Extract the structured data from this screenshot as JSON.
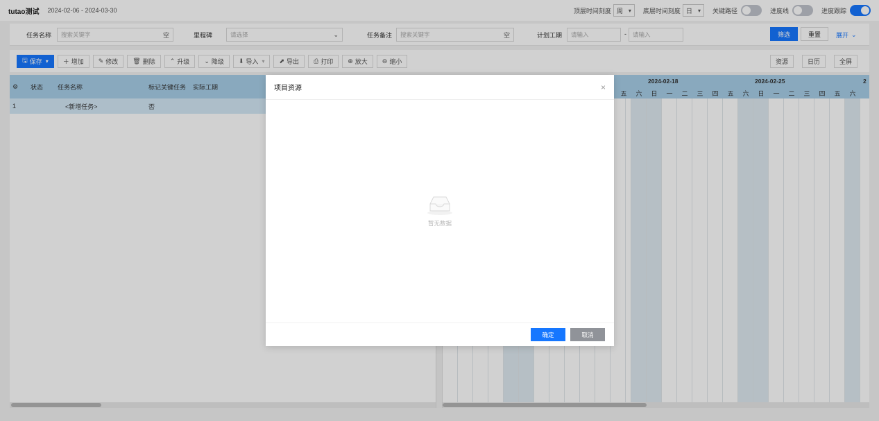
{
  "header": {
    "title": "tutao测试",
    "date_range": "2024-02-06 - 2024-03-30",
    "top_scale_label": "顶层时间刻度",
    "top_scale_value": "周",
    "bottom_scale_label": "底层时间刻度",
    "bottom_scale_value": "日",
    "critical_path_label": "关键路径",
    "progress_line_label": "进度线",
    "progress_track_label": "进度跟踪"
  },
  "filters": {
    "task_name_label": "任务名称",
    "task_name_placeholder": "搜索关键字",
    "empty_btn": "空",
    "milestone_label": "里程碑",
    "milestone_placeholder": "请选择",
    "task_note_label": "任务备注",
    "task_note_placeholder": "搜索关键字",
    "plan_duration_label": "计划工期",
    "plan_from_placeholder": "请输入",
    "range_sep": "-",
    "plan_to_placeholder": "请输入",
    "filter_btn": "筛选",
    "reset_btn": "重置",
    "expand_btn": "展开"
  },
  "toolbar": {
    "save": "保存",
    "add": "增加",
    "edit": "修改",
    "delete": "删除",
    "upgrade": "升级",
    "downgrade": "降级",
    "import": "导入",
    "export": "导出",
    "print": "打印",
    "zoom_in": "放大",
    "zoom_out": "缩小",
    "resources": "资源",
    "calendar": "日历",
    "fullscreen": "全屏"
  },
  "table": {
    "columns": [
      "状态",
      "任务名称",
      "标记关键任务",
      "实际工期"
    ],
    "rows": [
      {
        "index": "1",
        "name": "<新增任务>",
        "critical": "否"
      }
    ]
  },
  "gantt": {
    "weeks": [
      {
        "label": "2024-02-18"
      },
      {
        "label": "2024-02-25"
      },
      {
        "label": "2"
      }
    ],
    "days": [
      "五",
      "六",
      "日",
      "一",
      "二",
      "三",
      "四",
      "五",
      "六",
      "日",
      "一",
      "二",
      "三",
      "四",
      "五",
      "六"
    ]
  },
  "modal": {
    "title": "项目资源",
    "close": "×",
    "empty_text": "暂无数据",
    "ok": "确定",
    "cancel": "取消"
  }
}
